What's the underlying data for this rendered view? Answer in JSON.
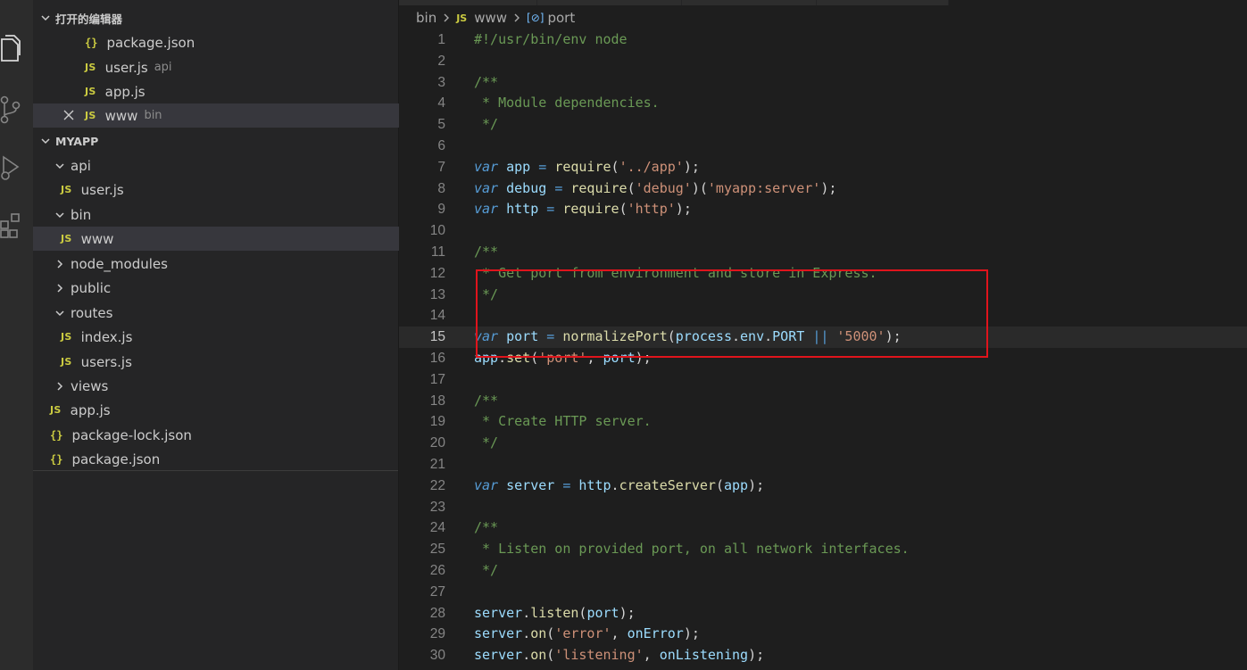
{
  "sidebar": {
    "open_editors_title": "打开的编辑器",
    "open_editors": [
      {
        "icon": "json",
        "name": "package.json",
        "desc": ""
      },
      {
        "icon": "js",
        "name": "user.js",
        "desc": "api"
      },
      {
        "icon": "js",
        "name": "app.js",
        "desc": ""
      },
      {
        "icon": "js",
        "name": "www",
        "desc": "bin"
      }
    ],
    "project_title": "MYAPP",
    "tree": {
      "api": "api",
      "api_user": "user.js",
      "bin": "bin",
      "bin_www": "www",
      "node_modules": "node_modules",
      "public": "public",
      "routes": "routes",
      "routes_index": "index.js",
      "routes_users": "users.js",
      "views": "views",
      "app": "app.js",
      "package_lock": "package-lock.json",
      "package": "package.json"
    },
    "icon_labels": {
      "js": "JS",
      "json": "{}"
    }
  },
  "breadcrumb": {
    "folder": "bin",
    "file": "www",
    "symbol": "port",
    "js_label": "JS",
    "sym_label": "[⊘]"
  },
  "editor": {
    "current_line": 15,
    "line_numbers": [
      "1",
      "2",
      "3",
      "4",
      "5",
      "6",
      "7",
      "8",
      "9",
      "10",
      "11",
      "12",
      "13",
      "14",
      "15",
      "16",
      "17",
      "18",
      "19",
      "20",
      "21",
      "22",
      "23",
      "24",
      "25",
      "26",
      "27",
      "28",
      "29",
      "30"
    ],
    "lines": [
      "#!/usr/bin/env node",
      "",
      "/**",
      " * Module dependencies.",
      " */",
      "",
      "var app = require('../app');",
      "var debug = require('debug')('myapp:server');",
      "var http = require('http');",
      "",
      "/**",
      " * Get port from environment and store in Express.",
      " */",
      "",
      "var port = normalizePort(process.env.PORT || '5000');",
      "app.set('port', port);",
      "",
      "/**",
      " * Create HTTP server.",
      " */",
      "",
      "var server = http.createServer(app);",
      "",
      "/**",
      " * Listen on provided port, on all network interfaces.",
      " */",
      "",
      "server.listen(port);",
      "server.on('error', onError);",
      "server.on('listening', onListening);"
    ]
  },
  "colors": {
    "highlight_box": "#e0141c",
    "comment": "#6a9955",
    "keyword": "#569cd6",
    "string": "#ce9178",
    "function": "#dcdcaa",
    "variable": "#9cdcfe"
  }
}
